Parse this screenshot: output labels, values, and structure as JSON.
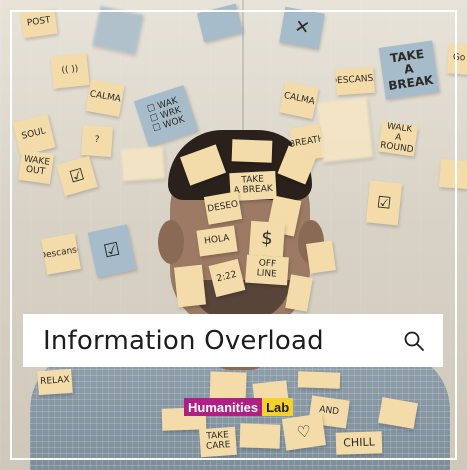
{
  "search": {
    "query": "Information Overload"
  },
  "logo": {
    "main": "Humanities",
    "accent": "Lab"
  },
  "notes": {
    "post": "POST",
    "calm": "CALMA",
    "ask": "?",
    "bulb": "(( ))",
    "todo": "☐ WAK\n☐ WRK\n☐ WOK",
    "take_break_big": "TAKE\nA\nBREAK",
    "go": "Go",
    "descansa": "DESCANSA",
    "calma_r": "CALMA",
    "breath": "BREATH",
    "walk": "WALK\nA ROUND",
    "hola": "HOLA",
    "deseo": "DESEO",
    "take_break_face": "TAKE\nA BREAK",
    "dollar": "$",
    "off_line": "OFF\nLINE",
    "num": "2:22",
    "descanso": "Descanso",
    "relax": "RELAX",
    "and": "AND",
    "chill": "CHILL",
    "take_care": "TAKE\nCARE",
    "wake": "WAKE\nOUT",
    "soul": "SOUL"
  }
}
